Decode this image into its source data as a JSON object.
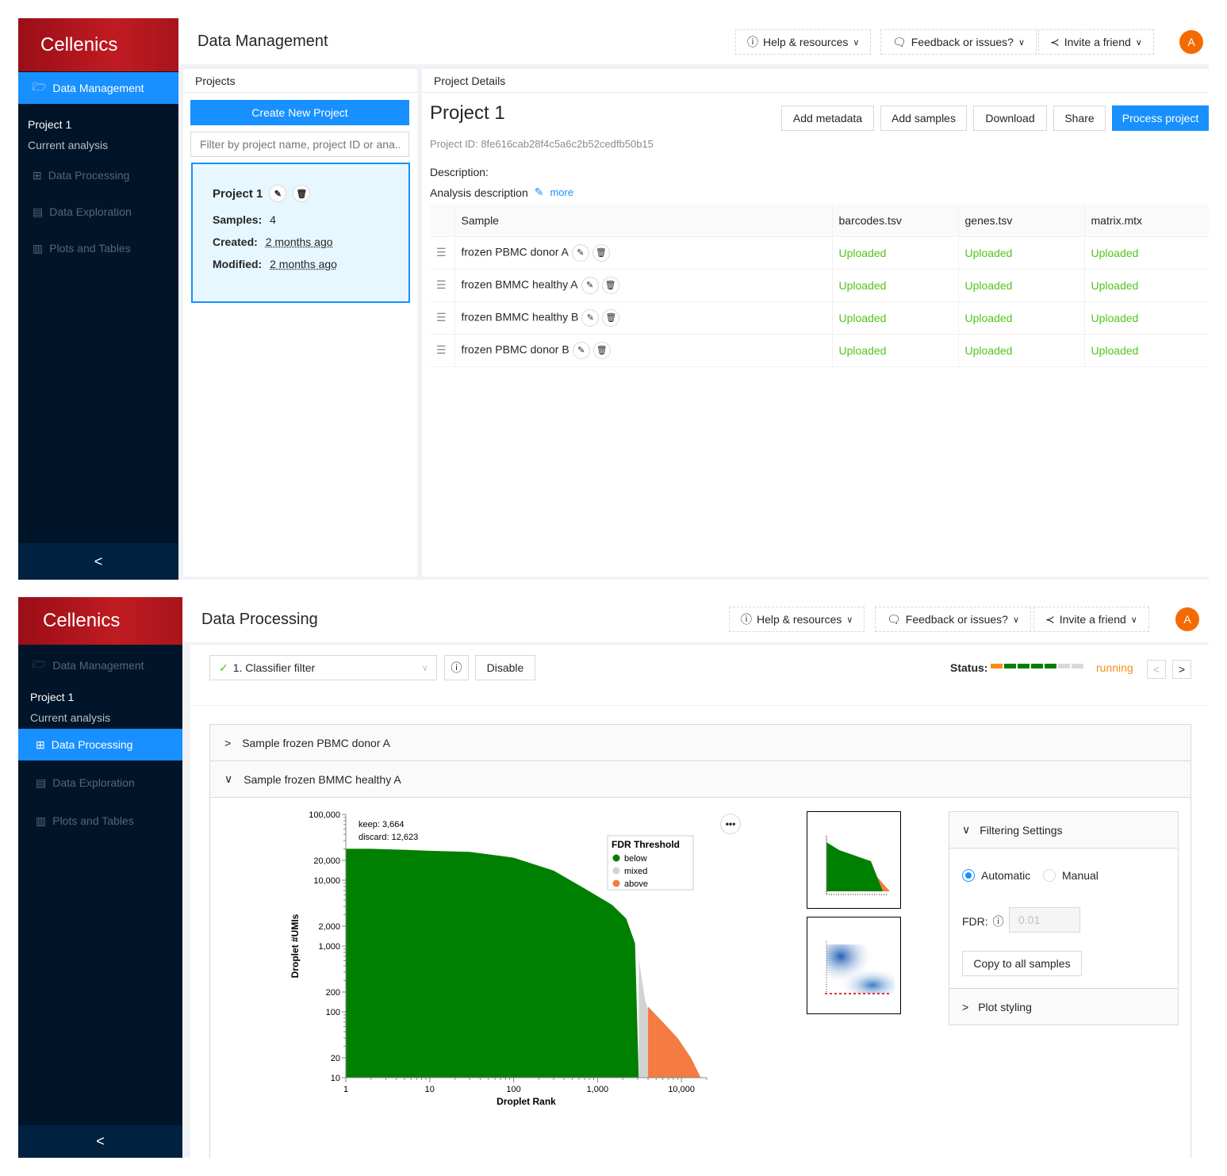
{
  "screen1": {
    "brand": "Cellenics",
    "nav": {
      "data_management": "Data Management",
      "project_title": "Project 1",
      "current_analysis": "Current analysis",
      "data_processing": "Data Processing",
      "data_exploration": "Data Exploration",
      "plots_tables": "Plots and Tables",
      "collapse": "<"
    },
    "header": {
      "title": "Data Management",
      "help": "Help & resources",
      "feedback": "Feedback or issues?",
      "invite": "Invite a friend",
      "avatar": "A"
    },
    "projects": {
      "title": "Projects",
      "create_button": "Create New Project",
      "filter_placeholder": "Filter by project name, project ID or ana...",
      "card": {
        "name": "Project 1",
        "samples_label": "Samples",
        "samples_value": "4",
        "created_label": "Created",
        "created_value": "2 months ago",
        "modified_label": "Modified",
        "modified_value": "2 months ago"
      }
    },
    "details": {
      "title": "Project Details",
      "project_name": "Project 1",
      "project_id": "Project ID: 8fe616cab28f4c5a6c2b52cedfb50b15",
      "description_label": "Description:",
      "analysis_description": "Analysis description",
      "more": "more",
      "buttons": {
        "add_metadata": "Add metadata",
        "add_samples": "Add samples",
        "download": "Download",
        "share": "Share",
        "process": "Process project"
      },
      "table": {
        "headers": [
          "Sample",
          "barcodes.tsv",
          "genes.tsv",
          "matrix.mtx"
        ],
        "rows": [
          {
            "sample": "frozen PBMC donor A",
            "barcodes": "Uploaded",
            "genes": "Uploaded",
            "matrix": "Uploaded"
          },
          {
            "sample": "frozen BMMC healthy A",
            "barcodes": "Uploaded",
            "genes": "Uploaded",
            "matrix": "Uploaded"
          },
          {
            "sample": "frozen BMMC healthy B",
            "barcodes": "Uploaded",
            "genes": "Uploaded",
            "matrix": "Uploaded"
          },
          {
            "sample": "frozen PBMC donor B",
            "barcodes": "Uploaded",
            "genes": "Uploaded",
            "matrix": "Uploaded"
          }
        ]
      }
    }
  },
  "screen2": {
    "brand": "Cellenics",
    "nav": {
      "data_management": "Data Management",
      "project_title": "Project 1",
      "current_analysis": "Current analysis",
      "data_processing": "Data Processing",
      "data_exploration": "Data Exploration",
      "plots_tables": "Plots and Tables",
      "collapse": "<"
    },
    "header": {
      "title": "Data Processing",
      "help": "Help & resources",
      "feedback": "Feedback or issues?",
      "invite": "Invite a friend",
      "avatar": "A"
    },
    "toolbar": {
      "step_select": "1. Classifier filter",
      "disable": "Disable",
      "status_label": "Status:",
      "status_value": "running",
      "status_segments": [
        "orange",
        "green",
        "green",
        "green",
        "green",
        "grey",
        "grey"
      ]
    },
    "samples": {
      "sample_a": "Sample frozen PBMC donor A",
      "sample_b": "Sample frozen BMMC healthy A"
    },
    "settings": {
      "filtering_title": "Filtering Settings",
      "automatic": "Automatic",
      "manual": "Manual",
      "fdr_label": "FDR:",
      "fdr_value": "0.01",
      "copy_button": "Copy to all samples",
      "plot_styling": "Plot styling"
    }
  },
  "chart_data": {
    "type": "area",
    "xscale": "log",
    "yscale": "log",
    "xlabel": "Droplet Rank",
    "ylabel": "Droplet #UMIs",
    "xticks": [
      "1",
      "10",
      "100",
      "1,000",
      "10,000"
    ],
    "yticks": [
      "10",
      "20",
      "100",
      "200",
      "1,000",
      "2,000",
      "10,000",
      "20,000",
      "100,000"
    ],
    "xlim": [
      1,
      20000
    ],
    "ylim": [
      10,
      100000
    ],
    "annotations": [
      "keep: 3,664",
      "discard: 12,623"
    ],
    "legend_title": "FDR Threshold",
    "legend_position": "top-right",
    "series": [
      {
        "name": "below",
        "color": "#008000",
        "x": [
          1,
          2,
          5,
          10,
          30,
          100,
          300,
          700,
          1500,
          2200,
          2800,
          3100
        ],
        "y": [
          30000,
          30000,
          29000,
          28000,
          27000,
          22000,
          14000,
          7500,
          4200,
          2600,
          1100,
          10
        ]
      },
      {
        "name": "mixed",
        "color": "#d3d3d3",
        "x": [
          3100,
          3400,
          3700,
          4000,
          4200
        ],
        "y": [
          650,
          300,
          150,
          110,
          10
        ]
      },
      {
        "name": "above",
        "color": "#f47b42",
        "x": [
          4000,
          6000,
          9000,
          13000,
          17000
        ],
        "y": [
          120,
          70,
          40,
          20,
          10
        ]
      }
    ],
    "legend": [
      {
        "label": "below",
        "color": "#008000"
      },
      {
        "label": "mixed",
        "color": "#d3d3d3"
      },
      {
        "label": "above",
        "color": "#f47b42"
      }
    ]
  }
}
